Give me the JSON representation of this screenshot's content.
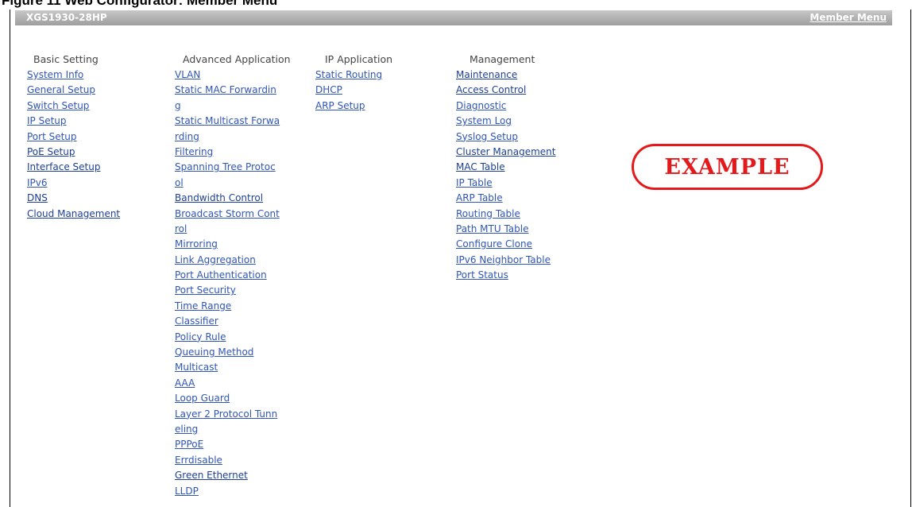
{
  "caption": "Figure 11 Web Configurator: Member Menu",
  "titlebar": {
    "model": "XGS1930-28HP",
    "member_menu": "Member Menu"
  },
  "basic": {
    "heading": "Basic Setting",
    "links": [
      "System Info",
      "General Setup",
      "Switch Setup",
      "IP Setup",
      "Port Setup",
      "PoE Setup",
      "Interface Setup",
      "IPv6",
      "DNS",
      "Cloud Management"
    ]
  },
  "advanced": {
    "heading": "Advanced Application",
    "links": [
      "VLAN",
      "Static MAC Forwardin",
      "g",
      "Static Multicast Forwa",
      "rding",
      "Filtering",
      "Spanning Tree Protoc",
      "ol",
      "Bandwidth Control",
      "Broadcast Storm Cont",
      "rol",
      "Mirroring",
      "Link Aggregation",
      "Port Authentication",
      "Port Security",
      "Time Range",
      "Classifier",
      "Policy Rule",
      "Queuing Method",
      "Multicast",
      "AAA",
      "Loop Guard",
      "Layer 2 Protocol Tunn",
      "eling",
      "PPPoE",
      "Errdisable",
      "Green Ethernet",
      "LLDP"
    ]
  },
  "ip_app": {
    "heading": "IP Application",
    "links": [
      "Static Routing",
      "DHCP",
      "ARP Setup"
    ]
  },
  "management": {
    "heading": "Management",
    "links": [
      "Maintenance",
      "Access Control",
      "Diagnostic",
      "System Log",
      "Syslog Setup",
      "Cluster Management",
      "MAC Table",
      "IP Table",
      "ARP Table",
      "Routing Table",
      "Path MTU Table",
      "Configure Clone",
      "IPv6 Neighbor Table",
      "Port Status"
    ]
  },
  "stamp": "EXAMPLE",
  "colors": {
    "link": "#2f55b8",
    "titlebar": "#b3b3b3",
    "stamp": "#e3191c"
  }
}
